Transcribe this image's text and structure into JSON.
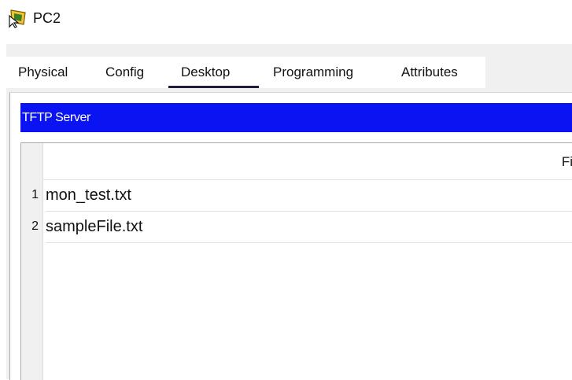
{
  "window": {
    "title": "PC2",
    "icon": "pc-cursor-icon"
  },
  "tabs": [
    {
      "label": "Physical"
    },
    {
      "label": "Config"
    },
    {
      "label": "Desktop",
      "active": true
    },
    {
      "label": "Programming"
    },
    {
      "label": "Attributes"
    }
  ],
  "panel": {
    "title": "TFTP Server",
    "accent_color": "#0a14f2"
  },
  "table": {
    "column_header": "Fi",
    "rows": [
      {
        "num": "1",
        "file": "mon_test.txt"
      },
      {
        "num": "2",
        "file": "sampleFile.txt"
      }
    ]
  }
}
